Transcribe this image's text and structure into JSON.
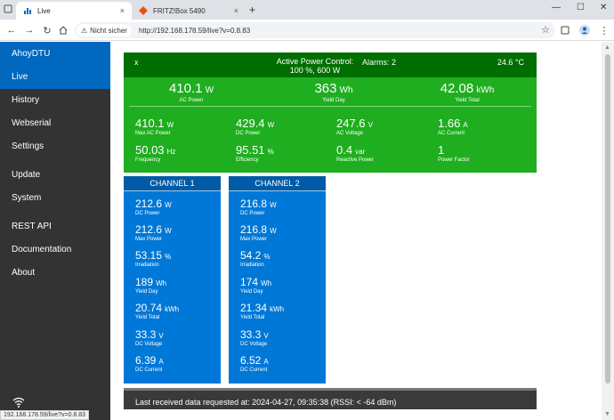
{
  "browser": {
    "tabs": [
      {
        "title": "Live",
        "close": "×"
      },
      {
        "title": "FRITZ!Box 5490",
        "close": "×"
      }
    ],
    "new_tab": "+",
    "window": {
      "minimize": "—",
      "maximize": "☐",
      "close": "✕"
    },
    "security_label": "Nicht sicher",
    "url": "http://192.168.178.59/live?v=0.8.83",
    "status_url": "192.168.178.59/live?v=0.8.83"
  },
  "sidebar": {
    "brand": "AhoyDTU",
    "items": [
      {
        "label": "Live"
      },
      {
        "label": "History"
      },
      {
        "label": "Webserial"
      },
      {
        "label": "Settings"
      },
      {
        "label": "Update"
      },
      {
        "label": "System"
      },
      {
        "label": "REST API"
      },
      {
        "label": "Documentation"
      },
      {
        "label": "About"
      }
    ]
  },
  "summary": {
    "x": "x",
    "apc_line1": "Active Power Control:",
    "apc_line2": "100 %, 600 W",
    "alarms": "Alarms: 2",
    "temp": "24.6 °C",
    "big": [
      {
        "value": "410.1",
        "unit": "W",
        "label": "AC Power"
      },
      {
        "value": "363",
        "unit": "Wh",
        "label": "Yield Day"
      },
      {
        "value": "42.08",
        "unit": "kWh",
        "label": "Yield Total"
      }
    ],
    "small": [
      {
        "value": "410.1",
        "unit": "W",
        "label": "Max AC Power"
      },
      {
        "value": "429.4",
        "unit": "W",
        "label": "DC Power"
      },
      {
        "value": "247.6",
        "unit": "V",
        "label": "AC Voltage"
      },
      {
        "value": "1.66",
        "unit": "A",
        "label": "AC Current"
      },
      {
        "value": "50.03",
        "unit": "Hz",
        "label": "Frequency"
      },
      {
        "value": "95.51",
        "unit": "%",
        "label": "Efficiency"
      },
      {
        "value": "0.4",
        "unit": "var",
        "label": "Reactive Power"
      },
      {
        "value": "1",
        "unit": "",
        "label": "Power Factor"
      }
    ]
  },
  "channels": [
    {
      "title": "CHANNEL 1",
      "rows": [
        {
          "value": "212.6",
          "unit": "W",
          "label": "DC Power"
        },
        {
          "value": "212.6",
          "unit": "W",
          "label": "Max Power"
        },
        {
          "value": "53.15",
          "unit": "%",
          "label": "Irradiation"
        },
        {
          "value": "189",
          "unit": "Wh",
          "label": "Yield Day"
        },
        {
          "value": "20.74",
          "unit": "kWh",
          "label": "Yield Total"
        },
        {
          "value": "33.3",
          "unit": "V",
          "label": "DC Voltage"
        },
        {
          "value": "6.39",
          "unit": "A",
          "label": "DC Current"
        }
      ]
    },
    {
      "title": "CHANNEL 2",
      "rows": [
        {
          "value": "216.8",
          "unit": "W",
          "label": "DC Power"
        },
        {
          "value": "216.8",
          "unit": "W",
          "label": "Max Power"
        },
        {
          "value": "54.2",
          "unit": "%",
          "label": "Irradiation"
        },
        {
          "value": "174",
          "unit": "Wh",
          "label": "Yield Day"
        },
        {
          "value": "21.34",
          "unit": "kWh",
          "label": "Yield Total"
        },
        {
          "value": "33.3",
          "unit": "V",
          "label": "DC Voltage"
        },
        {
          "value": "6.52",
          "unit": "A",
          "label": "DC Current"
        }
      ]
    }
  ],
  "footer": {
    "text": "Last received data requested at: 2024-04-27, 09:35:38 (RSSI: < -64 dBm)"
  },
  "colors": {
    "sidebar": "#333333",
    "accent": "#0068bf",
    "summary": "#1fae1f",
    "summary_head": "#006e00",
    "channel": "#0078d7"
  }
}
